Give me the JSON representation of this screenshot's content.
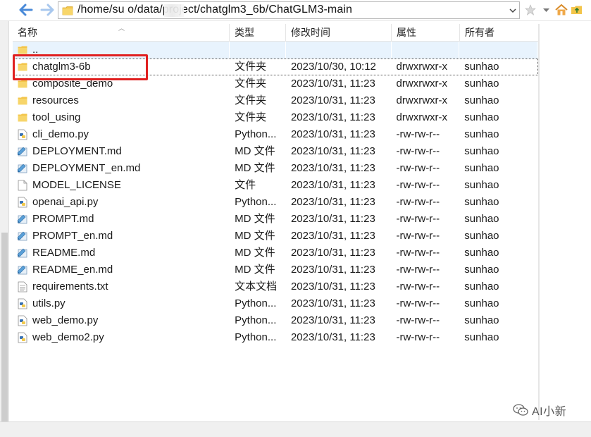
{
  "address_bar": {
    "path": "/home/su    o/data/project/chatglm3_6b/ChatGLM3-main"
  },
  "toolbar": {
    "back_icon": "arrow-left-icon",
    "forward_icon": "arrow-right-icon",
    "dropdown_icon": "chevron-down-icon",
    "icons": [
      "star-icon",
      "chevron-down-icon",
      "home-icon",
      "folder-up-icon"
    ]
  },
  "columns": {
    "name": "名称",
    "type": "类型",
    "modified": "修改时间",
    "attributes": "属性",
    "owner": "所有者"
  },
  "files": [
    {
      "name": "..",
      "type": "",
      "modified": "",
      "attributes": "",
      "owner": "",
      "icon": "folder-icon"
    },
    {
      "name": "chatglm3-6b",
      "type": "文件夹",
      "modified": "2023/10/30, 10:12",
      "attributes": "drwxrwxr-x",
      "owner": "sunhao",
      "icon": "folder-icon"
    },
    {
      "name": "composite_demo",
      "type": "文件夹",
      "modified": "2023/10/31, 11:23",
      "attributes": "drwxrwxr-x",
      "owner": "sunhao",
      "icon": "folder-icon"
    },
    {
      "name": "resources",
      "type": "文件夹",
      "modified": "2023/10/31, 11:23",
      "attributes": "drwxrwxr-x",
      "owner": "sunhao",
      "icon": "folder-icon"
    },
    {
      "name": "tool_using",
      "type": "文件夹",
      "modified": "2023/10/31, 11:23",
      "attributes": "drwxrwxr-x",
      "owner": "sunhao",
      "icon": "folder-icon"
    },
    {
      "name": "cli_demo.py",
      "type": "Python...",
      "modified": "2023/10/31, 11:23",
      "attributes": "-rw-rw-r--",
      "owner": "sunhao",
      "icon": "python-file-icon"
    },
    {
      "name": "DEPLOYMENT.md",
      "type": "MD 文件",
      "modified": "2023/10/31, 11:23",
      "attributes": "-rw-rw-r--",
      "owner": "sunhao",
      "icon": "markdown-file-icon"
    },
    {
      "name": "DEPLOYMENT_en.md",
      "type": "MD 文件",
      "modified": "2023/10/31, 11:23",
      "attributes": "-rw-rw-r--",
      "owner": "sunhao",
      "icon": "markdown-file-icon"
    },
    {
      "name": "MODEL_LICENSE",
      "type": "文件",
      "modified": "2023/10/31, 11:23",
      "attributes": "-rw-rw-r--",
      "owner": "sunhao",
      "icon": "blank-file-icon"
    },
    {
      "name": "openai_api.py",
      "type": "Python...",
      "modified": "2023/10/31, 11:23",
      "attributes": "-rw-rw-r--",
      "owner": "sunhao",
      "icon": "python-file-icon"
    },
    {
      "name": "PROMPT.md",
      "type": "MD 文件",
      "modified": "2023/10/31, 11:23",
      "attributes": "-rw-rw-r--",
      "owner": "sunhao",
      "icon": "markdown-file-icon"
    },
    {
      "name": "PROMPT_en.md",
      "type": "MD 文件",
      "modified": "2023/10/31, 11:23",
      "attributes": "-rw-rw-r--",
      "owner": "sunhao",
      "icon": "markdown-file-icon"
    },
    {
      "name": "README.md",
      "type": "MD 文件",
      "modified": "2023/10/31, 11:23",
      "attributes": "-rw-rw-r--",
      "owner": "sunhao",
      "icon": "markdown-file-icon"
    },
    {
      "name": "README_en.md",
      "type": "MD 文件",
      "modified": "2023/10/31, 11:23",
      "attributes": "-rw-rw-r--",
      "owner": "sunhao",
      "icon": "markdown-file-icon"
    },
    {
      "name": "requirements.txt",
      "type": "文本文档",
      "modified": "2023/10/31, 11:23",
      "attributes": "-rw-rw-r--",
      "owner": "sunhao",
      "icon": "text-file-icon"
    },
    {
      "name": "utils.py",
      "type": "Python...",
      "modified": "2023/10/31, 11:23",
      "attributes": "-rw-rw-r--",
      "owner": "sunhao",
      "icon": "python-file-icon"
    },
    {
      "name": "web_demo.py",
      "type": "Python...",
      "modified": "2023/10/31, 11:23",
      "attributes": "-rw-rw-r--",
      "owner": "sunhao",
      "icon": "python-file-icon"
    },
    {
      "name": "web_demo2.py",
      "type": "Python...",
      "modified": "2023/10/31, 11:23",
      "attributes": "-rw-rw-r--",
      "owner": "sunhao",
      "icon": "python-file-icon"
    }
  ],
  "watermark": {
    "text": "AI小新",
    "icon": "wechat-icon"
  },
  "colors": {
    "highlight_border": "#e02020",
    "folder": "#f3c54a",
    "up_row_bg": "#e8f3fd",
    "nav_arrow": "#4a8ad8"
  }
}
